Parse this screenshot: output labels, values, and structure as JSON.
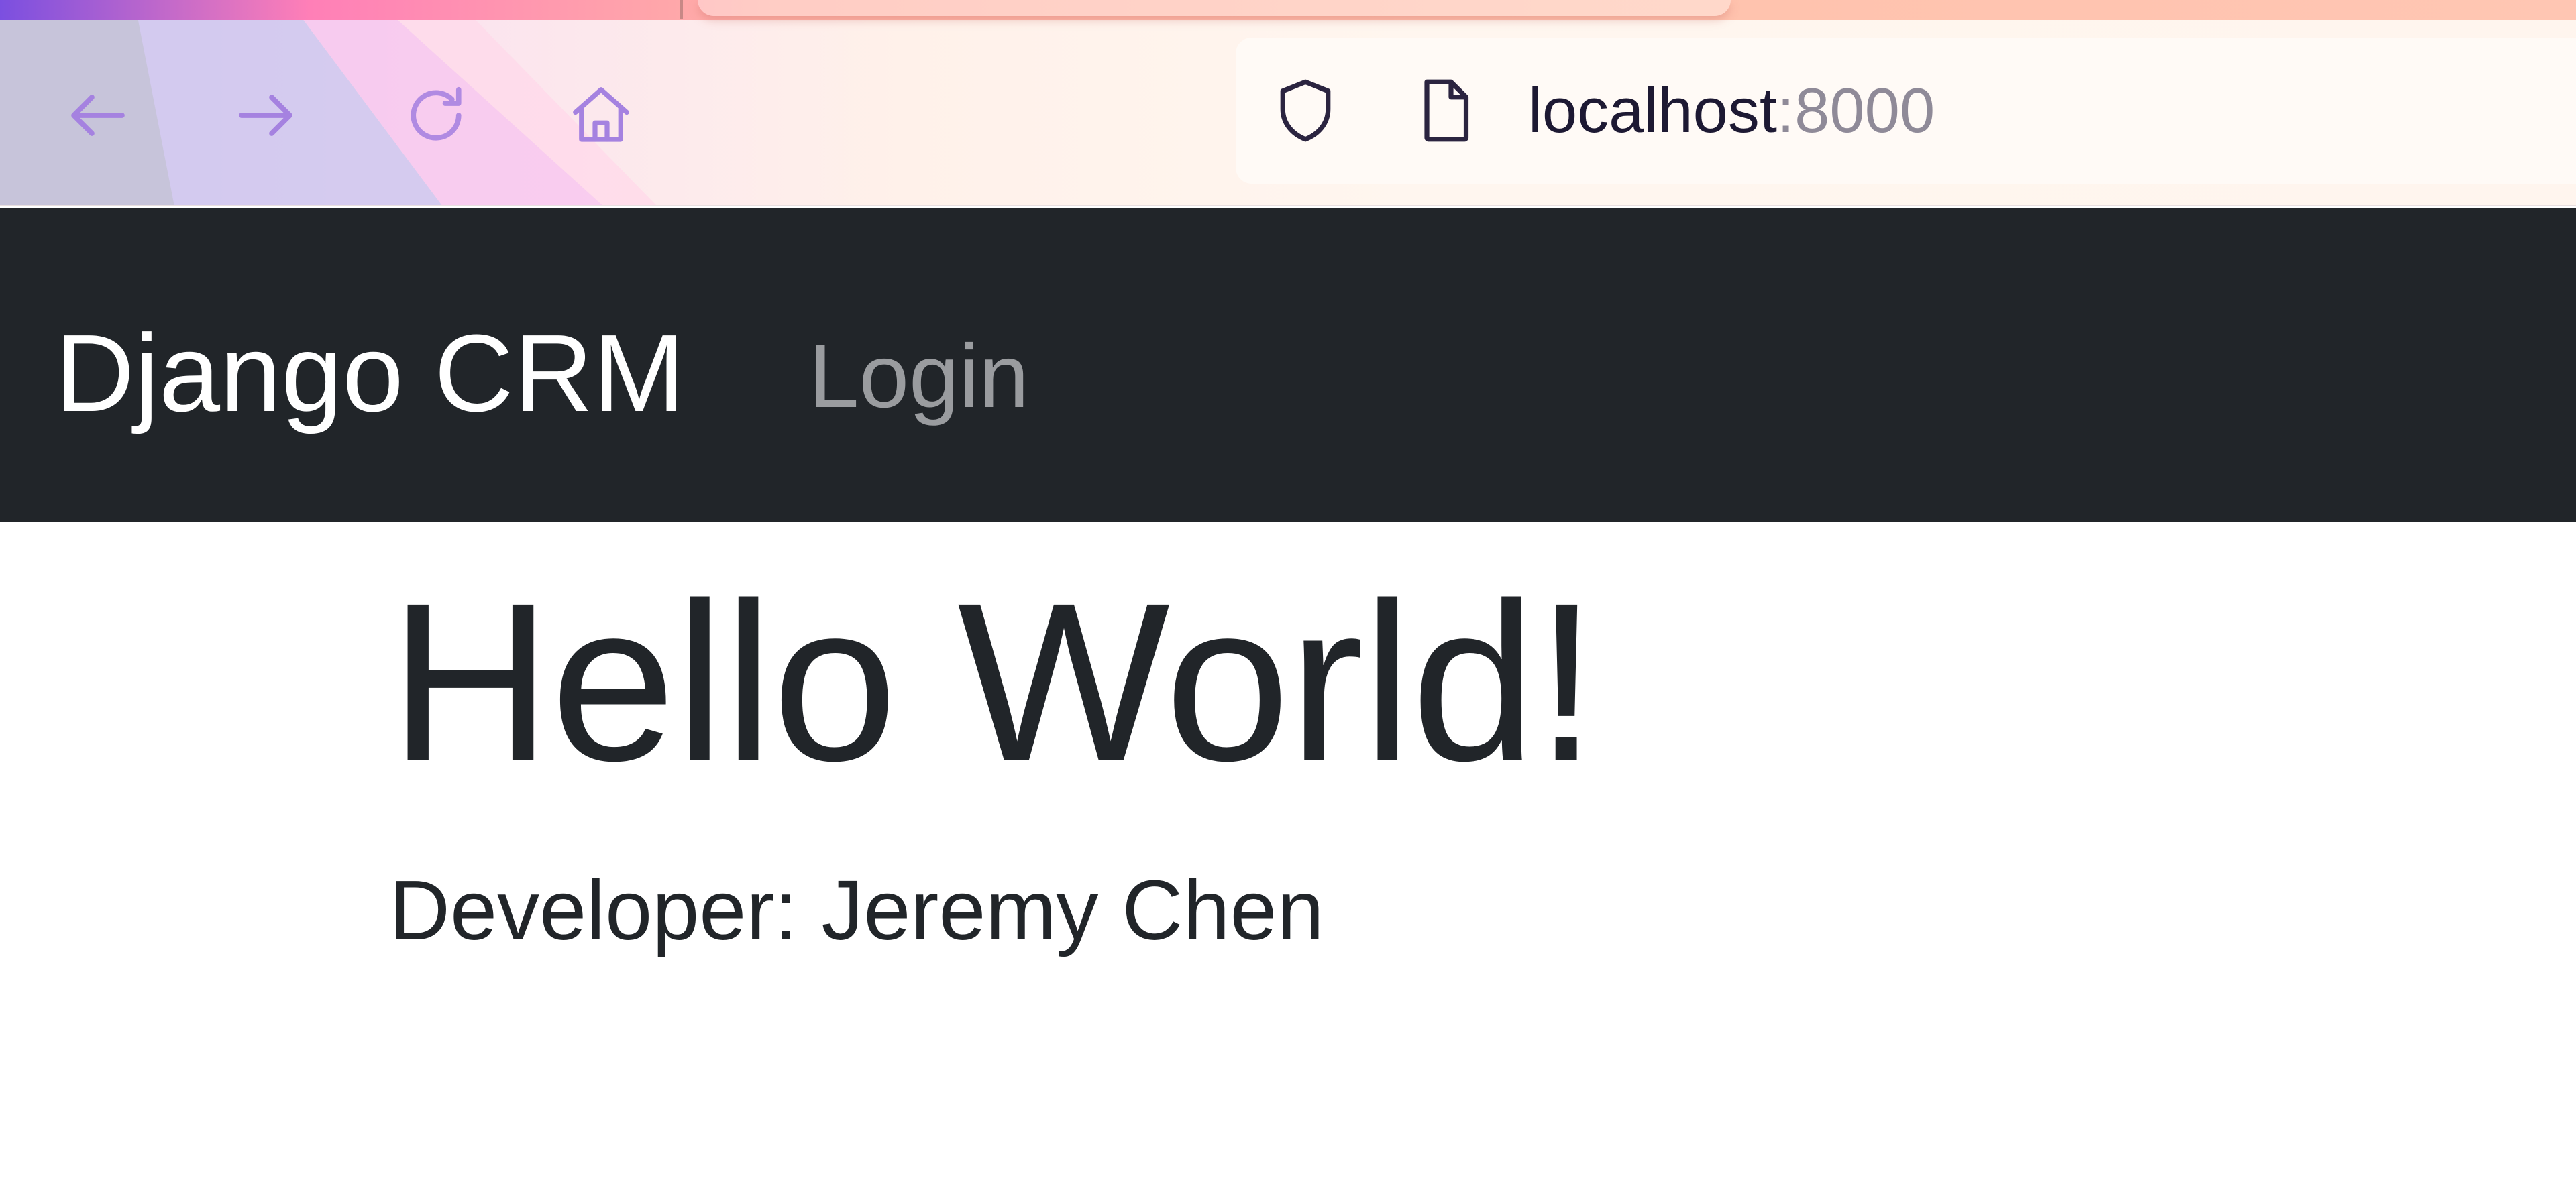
{
  "browser": {
    "url_host": "localhost",
    "url_port": ":8000",
    "icons": [
      "back-arrow-icon",
      "forward-arrow-icon",
      "reload-icon",
      "home-icon",
      "shield-icon",
      "page-icon"
    ],
    "icon_color": "#a582e0"
  },
  "navbar": {
    "brand": "Django CRM",
    "login_label": "Login",
    "background": "#212529"
  },
  "main": {
    "title": "Hello World!",
    "developer": "Developer: Jeremy Chen"
  }
}
